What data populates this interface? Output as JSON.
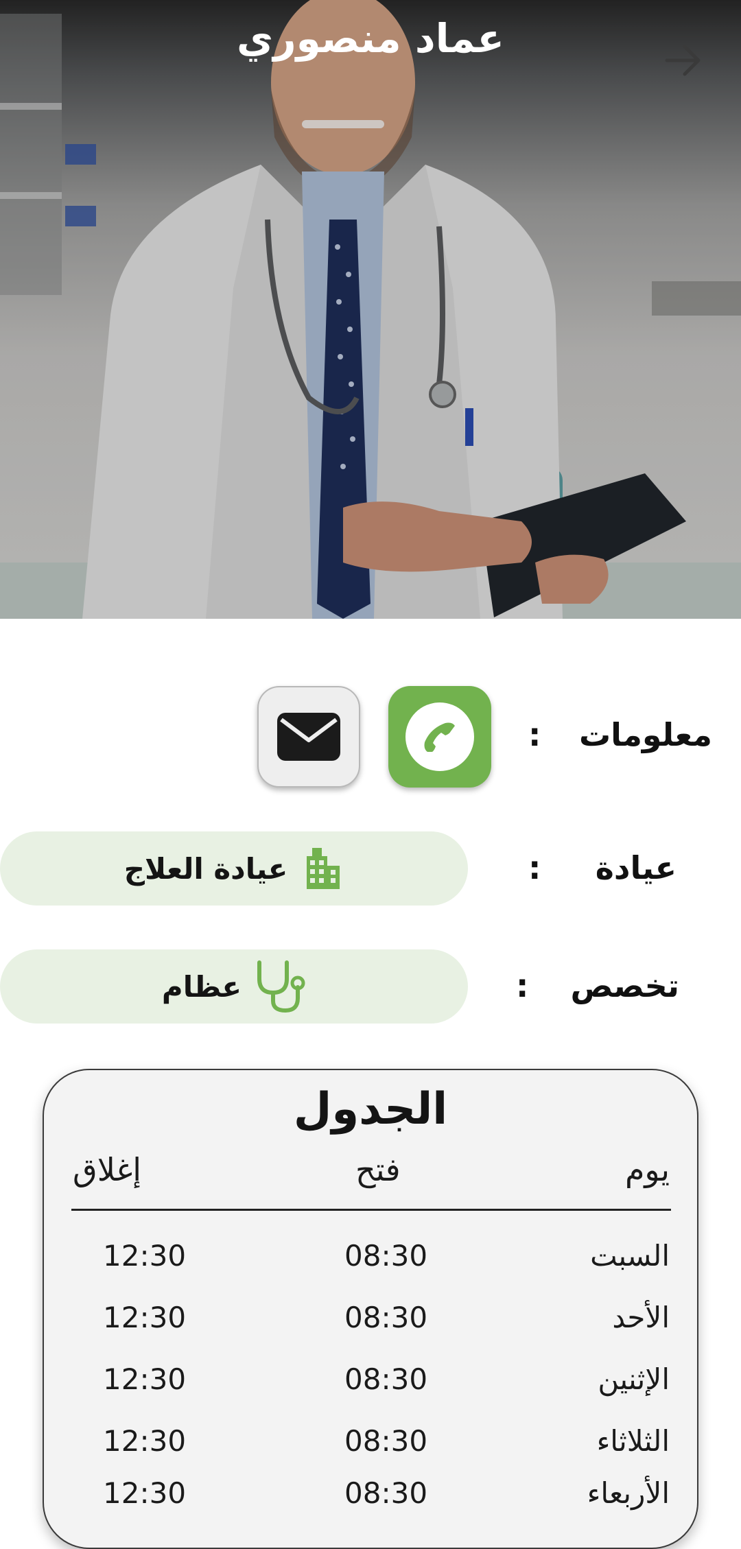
{
  "header": {
    "title": "عماد منصوري",
    "back_icon": "arrow-right-icon"
  },
  "info": {
    "contact_label": "معلومات",
    "colon": ":",
    "contact_buttons": [
      {
        "icon": "envelope-icon",
        "color": "#eeeeee"
      },
      {
        "icon": "phone-icon",
        "color": "#72b24e"
      }
    ],
    "clinic_label": "عيادة",
    "clinic_value": "عيادة العلاج",
    "clinic_icon": "building-icon",
    "specialty_label": "تخصص",
    "specialty_value": "عظام",
    "specialty_icon": "stethoscope-icon",
    "accent_color": "#72b24e",
    "pill_color": "#e8f1e3"
  },
  "schedule": {
    "title": "الجدول",
    "headers": {
      "day": "يوم",
      "open": "فتح",
      "close": "إغلاق"
    },
    "rows": [
      {
        "day": "السبت",
        "open": "08:30",
        "close": "12:30"
      },
      {
        "day": "الأحد",
        "open": "08:30",
        "close": "12:30"
      },
      {
        "day": "الإثنين",
        "open": "08:30",
        "close": "12:30"
      },
      {
        "day": "الثلاثاء",
        "open": "08:30",
        "close": "12:30"
      },
      {
        "day": "الأربعاء",
        "open": "08:30",
        "close": "12:30"
      }
    ]
  }
}
